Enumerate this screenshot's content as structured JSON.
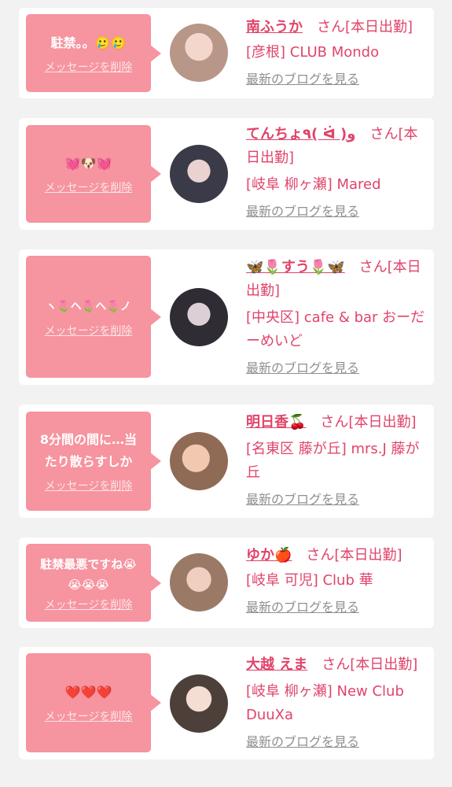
{
  "cards": [
    {
      "message": "駐禁。。🥲🥲",
      "delete_label": "メッセージを削除",
      "name": "南ふうか",
      "suffix": "さん[本日出勤]",
      "shop": "[彦根] CLUB Mondo",
      "blog_label": "最新のブログを見る",
      "avatar_color": "#c7b3a8"
    },
    {
      "message": "💓🐶💓",
      "delete_label": "メッセージを削除",
      "name": "てんちょ٩( ᐛ )و",
      "suffix": "さん[本日出勤]",
      "shop": "[岐阜 柳ヶ瀬] Mared",
      "blog_label": "最新のブログを見る",
      "avatar_color": "#5a5a68"
    },
    {
      "message": "ヽ🌷ヘ🌷ヘ🌷ノ",
      "delete_label": "メッセージを削除",
      "name": "🦋🌷すう🌷🦋",
      "suffix": "さん[本日出勤]",
      "shop": "[中央区] cafe & bar おーだーめいど",
      "blog_label": "最新のブログを見る",
      "avatar_color": "#4b4750"
    },
    {
      "message": "8分間の間に…当たり散らすしか",
      "delete_label": "メッセージを削除",
      "name": "明日香🍒",
      "suffix": "さん[本日出勤]",
      "shop": "[名東区 藤が丘] mrs.J 藤が丘",
      "blog_label": "最新のブログを見る",
      "avatar_color": "#c99a7e"
    },
    {
      "message": "駐禁最悪ですね😭😭😭😭",
      "delete_label": "メッセージを削除",
      "name": "ゆか🍎",
      "suffix": "さん[本日出勤]",
      "shop": "[岐阜 可児] Club 華",
      "blog_label": "最新のブログを見る",
      "avatar_color": "#a98a78"
    },
    {
      "message": "❤️❤️❤️",
      "delete_label": "メッセージを削除",
      "name": "大越 えま",
      "suffix": "さん[本日出勤]",
      "shop": "[岐阜 柳ヶ瀬] New Club DuuXa",
      "blog_label": "最新のブログを見る",
      "avatar_color": "#6e5e56"
    }
  ]
}
